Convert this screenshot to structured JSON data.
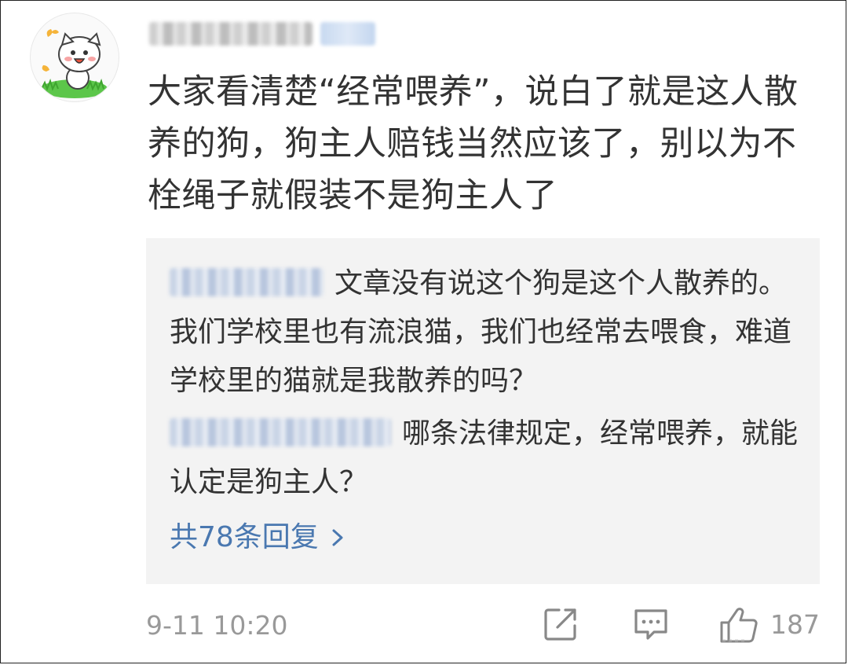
{
  "comment": {
    "text": "大家看清楚“经常喂养”，说白了就是这人散养的狗，狗主人赔钱当然应该了，别以为不栓绳子就假装不是狗主人了",
    "timestamp": "9-11 10:20",
    "like_count": "187"
  },
  "replies": [
    {
      "text": "文章没有说这个狗是这个人散养的。我们学校里也有流浪猫，我们也经常去喂食，难道学校里的猫就是我散养的吗？"
    },
    {
      "text": "哪条法律规定，经常喂养，就能认定是狗主人？"
    }
  ],
  "more_replies": {
    "label": "共78条回复"
  },
  "icons": {
    "share": "share-icon",
    "reply": "comment-icon",
    "like": "thumbs-up-icon",
    "more": "chevron-right-icon"
  },
  "colors": {
    "text": "#333333",
    "muted": "#999999",
    "link": "#4a78b0",
    "reply_bg": "#f3f3f3"
  }
}
